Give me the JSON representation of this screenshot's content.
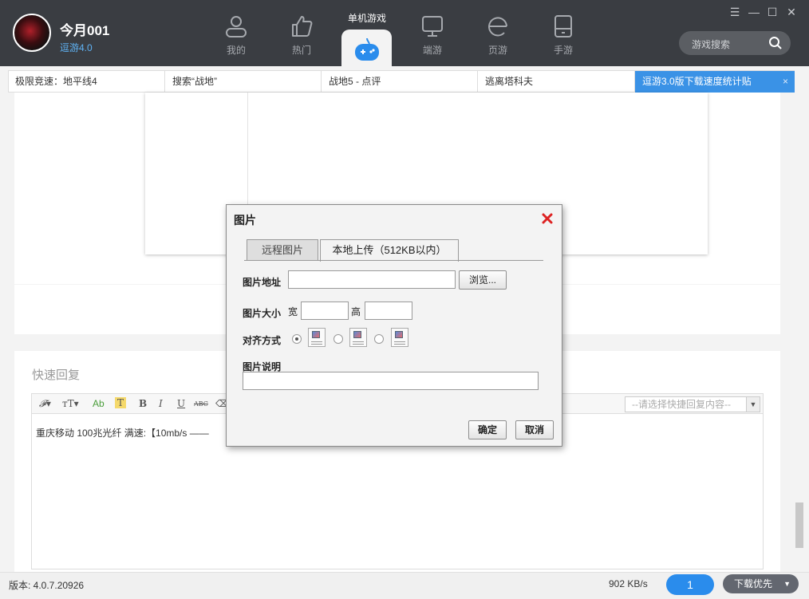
{
  "header": {
    "username": "今月001",
    "app_version_link": "逗游4.0",
    "nav": [
      {
        "label": "我的",
        "icon": "user-icon"
      },
      {
        "label": "热门",
        "icon": "thumbs-up-icon"
      },
      {
        "label": "单机游戏",
        "icon": "gamepad-icon",
        "active": true
      },
      {
        "label": "端游",
        "icon": "monitor-icon"
      },
      {
        "label": "页游",
        "icon": "browser-e-icon"
      },
      {
        "label": "手游",
        "icon": "tablet-icon"
      }
    ],
    "search_placeholder": "游戏搜索",
    "window_controls": [
      "menu-icon",
      "minimize-icon",
      "maximize-icon",
      "close-icon"
    ]
  },
  "tabs": [
    {
      "label": "极限竞速：地平线4"
    },
    {
      "label": "搜索“战地”"
    },
    {
      "label": "战地5 - 点评"
    },
    {
      "label": "逃离塔科夫"
    },
    {
      "label": "逗游3.0版下载速度统计贴",
      "active": true
    }
  ],
  "reply": {
    "title": "快速回复",
    "quick_select_placeholder": "--请选择快捷回复内容--",
    "content": "重庆移动  100兆光纤    满速:【10mb/s ——"
  },
  "dialog": {
    "title": "图片",
    "tabs": [
      "远程图片",
      "本地上传（512KB以内）"
    ],
    "active_tab": 1,
    "url_label": "图片地址",
    "url_value": "",
    "browse_label": "浏览...",
    "size_label": "图片大小",
    "width_label": "宽",
    "height_label": "高",
    "width_value": "",
    "height_value": "",
    "align_label": "对齐方式",
    "align_selected": 0,
    "desc_label": "图片说明",
    "desc_value": "",
    "ok_label": "确定",
    "cancel_label": "取消"
  },
  "status": {
    "version": "版本: 4.0.7.20926",
    "speed": "902 KB/s",
    "download_count": "1",
    "download_priority": "下载优先"
  },
  "colors": {
    "titlebar": "#3a3d42",
    "accent": "#3a92e6",
    "link": "#5fb3f5"
  }
}
